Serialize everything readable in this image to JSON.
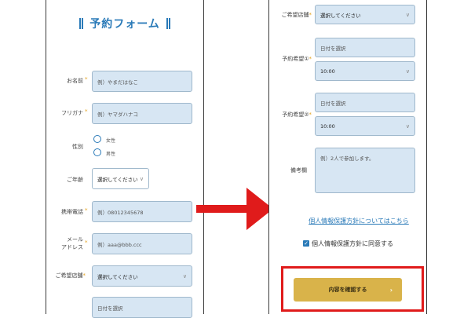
{
  "left_form": {
    "title": "予約フォーム",
    "name": {
      "label": "お名前",
      "placeholder": "例）やまだはなこ"
    },
    "furigana": {
      "label": "フリガナ",
      "placeholder": "例）ヤマダハナコ"
    },
    "gender": {
      "label": "性別",
      "options": [
        "女性",
        "男性"
      ]
    },
    "age": {
      "label": "ご年齢",
      "value": "選択してください"
    },
    "phone": {
      "label": "携帯電話",
      "placeholder": "例）08012345678"
    },
    "email": {
      "label_line1": "メール",
      "label_line2": "アドレス",
      "placeholder": "例）aaa@bbb.ccc"
    },
    "store": {
      "label": "ご希望店舗",
      "value": "選択してください"
    },
    "date1": {
      "placeholder": "日付を選択"
    }
  },
  "right_form": {
    "store": {
      "label": "ご希望店舗",
      "value": "選択してください"
    },
    "pref1": {
      "label": "予約希望",
      "num": "①",
      "date_placeholder": "日付を選択",
      "time": "10:00"
    },
    "pref2": {
      "label": "予約希望",
      "num": "②",
      "date_placeholder": "日付を選択",
      "time": "10:00"
    },
    "notes": {
      "label": "備考欄",
      "placeholder": "例）2人で参加します。"
    },
    "privacy_link": "個人情報保護方針についてはこちら",
    "consent": "個人情報保護方針に同意する",
    "confirm_button": "内容を確認する"
  },
  "colors": {
    "accent": "#2a7ab8",
    "required": "#e5a21c",
    "field_bg": "#d7e6f3",
    "button": "#d9b34a",
    "highlight": "#e01b1b"
  },
  "icons": {
    "required_mark": "*",
    "chevron": "chevron-down-icon",
    "arrow": "right-arrow-icon",
    "check": "checkbox-check-icon"
  }
}
